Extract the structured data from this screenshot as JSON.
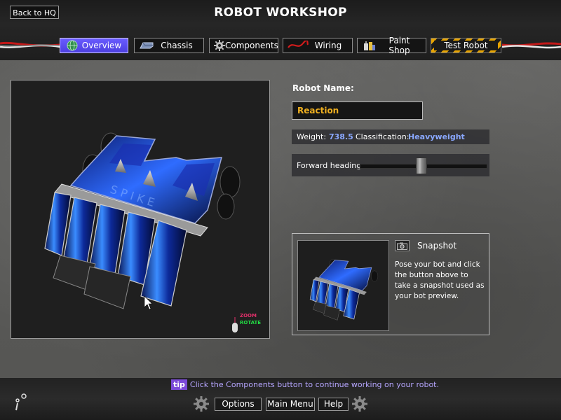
{
  "header": {
    "back_label": "Back to HQ",
    "title": "ROBOT WORKSHOP"
  },
  "tabs": [
    {
      "label": "Overview",
      "icon": "globe-icon",
      "active": true
    },
    {
      "label": "Chassis",
      "icon": "chassis-icon",
      "active": false
    },
    {
      "label": "Components",
      "icon": "gear-icon",
      "active": false
    },
    {
      "label": "Wiring",
      "icon": "wire-icon",
      "active": false
    },
    {
      "label": "Paint Shop",
      "icon": "paint-cans-icon",
      "active": false
    },
    {
      "label": "Test Robot",
      "icon": "",
      "active": false
    }
  ],
  "viewport": {
    "zoom_hint": "ZOOM",
    "rotate_hint": "ROTATE"
  },
  "robot": {
    "name_label": "Robot Name:",
    "name_value": "Reaction",
    "weight_label": "Weight:",
    "weight_value": "738.5",
    "class_label": "Classification:",
    "class_value": "Heavyweight",
    "heading_label": "Forward heading:",
    "heading_level": 0.49
  },
  "snapshot": {
    "title": "Snapshot",
    "description": "Pose your bot and click the button above to take a snapshot used as your bot preview."
  },
  "footer": {
    "tip_badge": "tip",
    "tip_text": "Click the Components button to continue working on your robot.",
    "options_label": "Options",
    "main_menu_label": "Main Menu",
    "help_label": "Help"
  },
  "colors": {
    "accent_blue": "#8aa8ff",
    "name_orange": "#f0b020",
    "active_tab": "#5a4cf0",
    "tip_purple": "#7c4ad8"
  }
}
